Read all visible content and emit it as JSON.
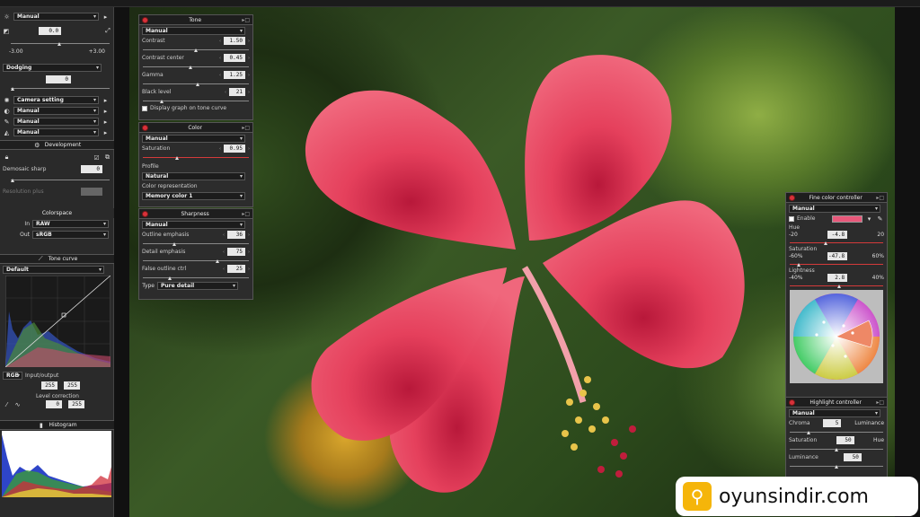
{
  "left": {
    "exposure_mode": "Manual",
    "exposure_value": "0.0",
    "exposure_min": "-3.00",
    "exposure_max": "+3.00",
    "dodging_label": "Dodging",
    "dodging_value": "0",
    "camera_setting": "Camera setting",
    "manual_1": "Manual",
    "manual_2": "Manual",
    "manual_3": "Manual",
    "development_title": "Development",
    "demosaic_label": "Demosaic sharp",
    "demosaic_value": "0",
    "resolution_label": "Resolution plus",
    "colorspace_title": "Colorspace",
    "in_label": "In",
    "in_value": "RAW",
    "out_label": "Out",
    "out_value": "sRGB",
    "tone_curve_title": "Tone curve",
    "tone_curve_mode": "Default",
    "channel": "RGB",
    "input_output_label": "Input/output",
    "io_in": "255",
    "io_out": "255",
    "level_label": "Level correction",
    "level_low": "0",
    "level_high": "255",
    "histogram_title": "Histogram"
  },
  "tone": {
    "title": "Tone",
    "mode": "Manual",
    "contrast_label": "Contrast",
    "contrast": "1.50",
    "contrast_center_label": "Contrast center",
    "contrast_center": "0.45",
    "gamma_label": "Gamma",
    "gamma": "1.25",
    "black_label": "Black level",
    "black": "21",
    "graph_label": "Display graph on tone curve",
    "contrast_pos": 0.5,
    "contrast_center_pos": 0.45,
    "gamma_pos": 0.52,
    "black_pos": 0.18
  },
  "color": {
    "title": "Color",
    "mode": "Manual",
    "saturation_label": "Saturation",
    "saturation": "0.95",
    "profile_label": "Profile",
    "profile": "Natural",
    "representation_label": "Color representation",
    "representation": "Memory color 1",
    "saturation_pos": 0.32
  },
  "sharpness": {
    "title": "Sharpness",
    "mode": "Manual",
    "outline_label": "Outline emphasis",
    "outline": "36",
    "detail_label": "Detail emphasis",
    "detail": "75",
    "false_label": "False outline ctrl",
    "false": "25",
    "type_label": "Type",
    "type": "Pure detail",
    "outline_pos": 0.3,
    "detail_pos": 0.7,
    "false_pos": 0.25
  },
  "fine": {
    "title": "Fine color controller",
    "mode": "Manual",
    "enable_label": "Enable",
    "hue_label": "Hue",
    "hue_min": "-20",
    "hue": "-4.8",
    "hue_max": "20",
    "sat_label": "Saturation",
    "sat_min": "-60%",
    "sat": "-47.8",
    "sat_max": "60%",
    "light_label": "Lightness",
    "light_min": "-40%",
    "light": "2.8",
    "light_max": "40%",
    "swatch_color": "#e8587a",
    "hue_pos": 0.38,
    "sat_pos": 0.1,
    "light_pos": 0.53
  },
  "highlight": {
    "title": "Highlight controller",
    "mode": "Manual",
    "chroma_label": "Chroma",
    "chroma": "5",
    "luminance_right": "Luminance",
    "saturation_label": "Saturation",
    "saturation": "50",
    "hue_right": "Hue",
    "luminance_label": "Luminance",
    "luminance": "50",
    "chroma_pos": 0.2,
    "saturation_pos": 0.5,
    "luminance_pos": 0.5
  },
  "badge": {
    "text": "oyunsindir.com"
  }
}
